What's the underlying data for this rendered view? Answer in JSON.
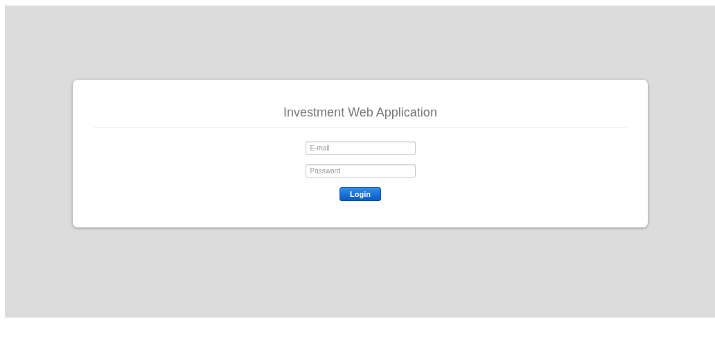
{
  "login_card": {
    "title": "Investment Web Application",
    "email": {
      "placeholder": "E-mail"
    },
    "password": {
      "placeholder": "Password"
    },
    "button": "Login"
  }
}
